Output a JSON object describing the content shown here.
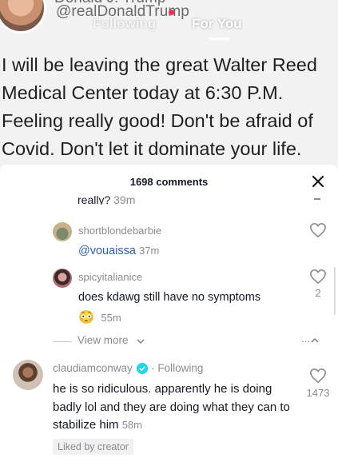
{
  "video": {
    "author_handle": "@realDonaldTrump",
    "author_name_cut": "Donald J. Trump",
    "tabs": {
      "following": "Following",
      "for_you": "For You",
      "active": "For You"
    },
    "tweet_text": "I will be leaving the great Walter Reed\nMedical Center today at 6:30 P.M.\nFeeling really good! Don't be afraid of\nCovid. Don't let it dominate your life."
  },
  "comments_panel": {
    "count_label": "1698 comments",
    "close_icon": "close-icon",
    "cut_off_row": {
      "text": "really?",
      "time": "39m"
    },
    "replies": [
      {
        "username": "shortblondebarbie",
        "mention": "@vouaissa",
        "time": "37m",
        "like_icon": "heart-outline-icon",
        "likes": ""
      },
      {
        "username": "spicyitalianice",
        "text": "does kdawg still have no symptoms",
        "emoji": "😳",
        "time": "55m",
        "like_icon": "heart-outline-icon",
        "likes": "2"
      }
    ],
    "view_more": {
      "label": "View more",
      "collapse_dots": "..."
    },
    "main_comment": {
      "username": "claudiamconway",
      "verified": true,
      "separator": "·",
      "follow_status": "Following",
      "text": "he is so ridiculous. apparently he is doing badly lol and they are doing what they can to stabilize him",
      "time": "58m",
      "likes": "1473",
      "badge": "Liked by creator"
    }
  },
  "colors": {
    "mention": "#2b5db9",
    "secondary_text": "#8a8b91",
    "verified": "#20d5ec",
    "record_dot": "#fe2c55"
  }
}
